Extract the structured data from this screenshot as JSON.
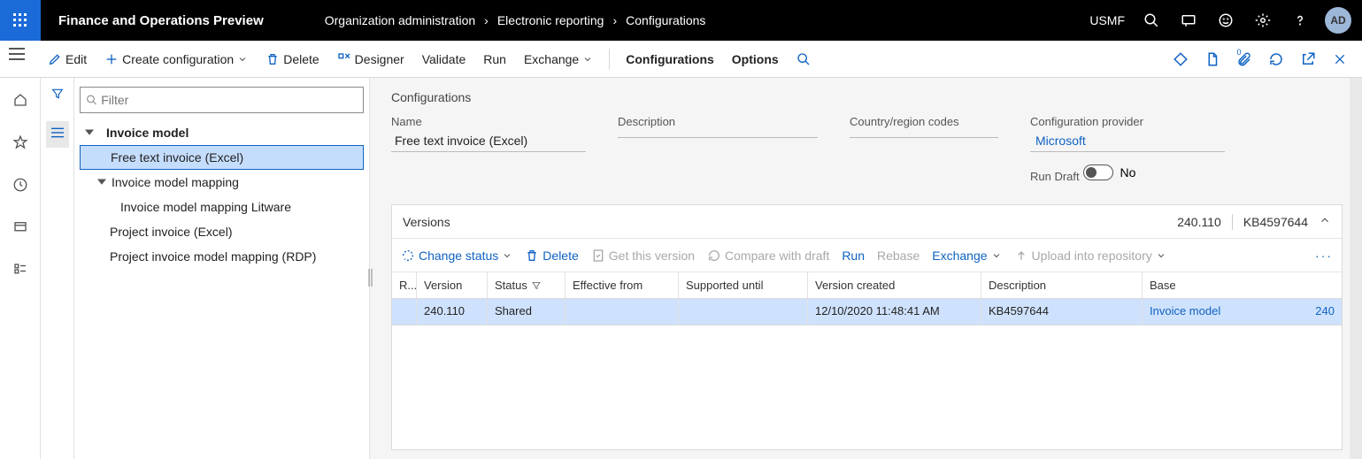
{
  "header": {
    "app_title": "Finance and Operations Preview",
    "breadcrumbs": [
      "Organization administration",
      "Electronic reporting",
      "Configurations"
    ],
    "entity": "USMF",
    "avatar": "AD"
  },
  "cmdbar": {
    "edit": "Edit",
    "create": "Create configuration",
    "delete": "Delete",
    "designer": "Designer",
    "validate": "Validate",
    "run": "Run",
    "exchange": "Exchange",
    "configurations": "Configurations",
    "options": "Options"
  },
  "filter": {
    "placeholder": "Filter"
  },
  "tree": {
    "root": "Invoice model",
    "n1": "Free text invoice (Excel)",
    "n2": "Invoice model mapping",
    "n2a": "Invoice model mapping Litware",
    "n3": "Project invoice (Excel)",
    "n4": "Project invoice model mapping (RDP)"
  },
  "main": {
    "title": "Configurations",
    "labels": {
      "name": "Name",
      "description": "Description",
      "country": "Country/region codes",
      "provider": "Configuration provider",
      "run_draft": "Run Draft"
    },
    "values": {
      "name": "Free text invoice (Excel)",
      "description": "",
      "country": "",
      "provider": "Microsoft",
      "run_draft": "No"
    }
  },
  "versions": {
    "title": "Versions",
    "summary_version": "240.110",
    "summary_desc": "KB4597644",
    "toolbar": {
      "change_status": "Change status",
      "delete": "Delete",
      "get": "Get this version",
      "compare": "Compare with draft",
      "run": "Run",
      "rebase": "Rebase",
      "exchange": "Exchange",
      "upload": "Upload into repository"
    },
    "columns": {
      "r": "R...",
      "version": "Version",
      "status": "Status",
      "effective": "Effective from",
      "supported": "Supported until",
      "created": "Version created",
      "description": "Description",
      "base": "Base"
    },
    "row": {
      "version": "240.110",
      "status": "Shared",
      "effective": "",
      "supported": "",
      "created": "12/10/2020 11:48:41 AM",
      "description": "KB4597644",
      "base": "Invoice model",
      "base_version": "240"
    }
  }
}
